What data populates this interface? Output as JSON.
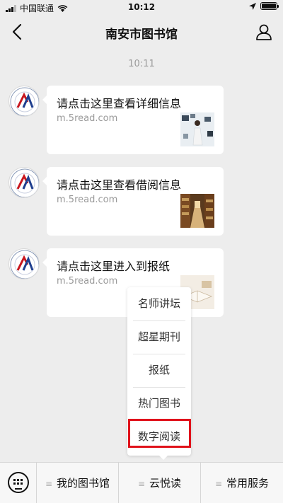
{
  "status_bar": {
    "carrier": "中国联通",
    "time": "10:12"
  },
  "nav": {
    "title": "南安市图书馆"
  },
  "timestamp": "10:11",
  "messages": [
    {
      "title": "请点击这里查看详细信息",
      "url": "m.5read.com"
    },
    {
      "title": "请点击这里查看借阅信息",
      "url": "m.5read.com"
    },
    {
      "title": "请点击这里进入到报纸",
      "url": "m.5read.com"
    }
  ],
  "popup_menu": {
    "items": [
      "名师讲坛",
      "超星期刊",
      "报纸",
      "热门图书",
      "数字阅读"
    ],
    "highlighted": "数字阅读",
    "highlight_color": "#e0121b"
  },
  "bottom_menu": {
    "tabs": [
      "我的图书馆",
      "云悦读",
      "常用服务"
    ]
  },
  "icons": {
    "back": "chevron-left-icon",
    "user": "user-icon",
    "keyboard": "keyboard-icon",
    "menu": "menu-lines-icon"
  }
}
